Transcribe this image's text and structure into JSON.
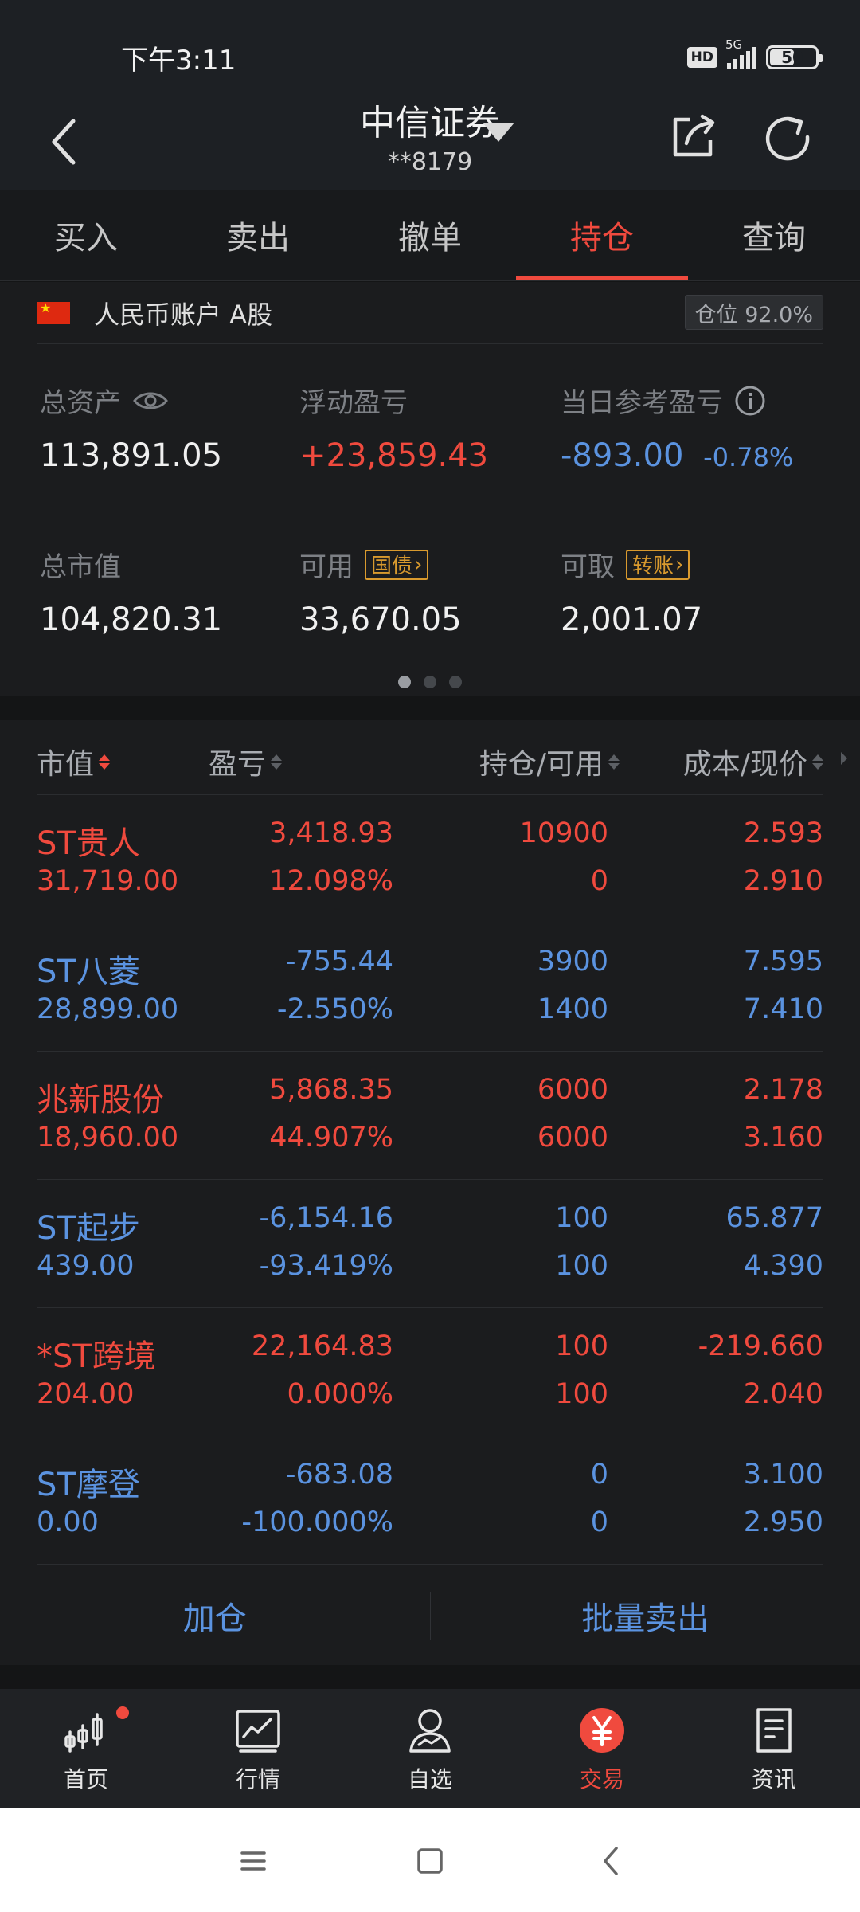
{
  "status_bar": {
    "time": "下午3:11",
    "hd": "HD",
    "network": "5G",
    "battery": "50"
  },
  "header": {
    "broker": "中信证券",
    "account": "**8179"
  },
  "tabs": [
    {
      "label": "买入",
      "active": false
    },
    {
      "label": "卖出",
      "active": false
    },
    {
      "label": "撤单",
      "active": false
    },
    {
      "label": "持仓",
      "active": true
    },
    {
      "label": "查询",
      "active": false
    }
  ],
  "account": {
    "label": "人民币账户 A股",
    "position_ratio": "仓位 92.0%"
  },
  "summary": {
    "total_assets": {
      "label": "总资产",
      "value": "113,891.05"
    },
    "floating_pl": {
      "label": "浮动盈亏",
      "value": "+23,859.43"
    },
    "daily_pl": {
      "label": "当日参考盈亏",
      "value": "-893.00",
      "percent": "-0.78%"
    },
    "market_value": {
      "label": "总市值",
      "value": "104,820.31"
    },
    "available": {
      "label": "可用",
      "tag": "国债",
      "value": "33,670.05"
    },
    "withdrawable": {
      "label": "可取",
      "tag": "转账",
      "value": "2,001.07"
    }
  },
  "holdings": {
    "columns": [
      "市值",
      "盈亏",
      "持仓/可用",
      "成本/现价"
    ],
    "rows": [
      {
        "name": "ST贵人",
        "market_value": "31,719.00",
        "pl": "3,418.93",
        "pl_pct": "12.098%",
        "hold": "10900",
        "avail": "0",
        "cost": "2.593",
        "price": "2.910",
        "color": "red"
      },
      {
        "name": "ST八菱",
        "market_value": "28,899.00",
        "pl": "-755.44",
        "pl_pct": "-2.550%",
        "hold": "3900",
        "avail": "1400",
        "cost": "7.595",
        "price": "7.410",
        "color": "blue"
      },
      {
        "name": "兆新股份",
        "market_value": "18,960.00",
        "pl": "5,868.35",
        "pl_pct": "44.907%",
        "hold": "6000",
        "avail": "6000",
        "cost": "2.178",
        "price": "3.160",
        "color": "red"
      },
      {
        "name": "ST起步",
        "market_value": "439.00",
        "pl": "-6,154.16",
        "pl_pct": "-93.419%",
        "hold": "100",
        "avail": "100",
        "cost": "65.877",
        "price": "4.390",
        "color": "blue"
      },
      {
        "name": "*ST跨境",
        "market_value": "204.00",
        "pl": "22,164.83",
        "pl_pct": "0.000%",
        "hold": "100",
        "avail": "100",
        "cost": "-219.660",
        "price": "2.040",
        "color": "red"
      },
      {
        "name": "ST摩登",
        "market_value": "0.00",
        "pl": "-683.08",
        "pl_pct": "-100.000%",
        "hold": "0",
        "avail": "0",
        "cost": "3.100",
        "price": "2.950",
        "color": "blue"
      }
    ]
  },
  "actions": {
    "add": "加仓",
    "batch_sell": "批量卖出"
  },
  "bottom_nav": [
    {
      "label": "首页",
      "icon": "candlestick-icon",
      "badge": true
    },
    {
      "label": "行情",
      "icon": "chart-icon",
      "badge": false
    },
    {
      "label": "自选",
      "icon": "watchlist-icon",
      "badge": false
    },
    {
      "label": "交易",
      "icon": "yuan-icon",
      "badge": false,
      "active": true
    },
    {
      "label": "资讯",
      "icon": "news-icon",
      "badge": false
    }
  ],
  "colors": {
    "up": "#f04a3e",
    "down": "#5b93e0",
    "accent": "#f04a3e",
    "tag": "#d99a2e"
  }
}
